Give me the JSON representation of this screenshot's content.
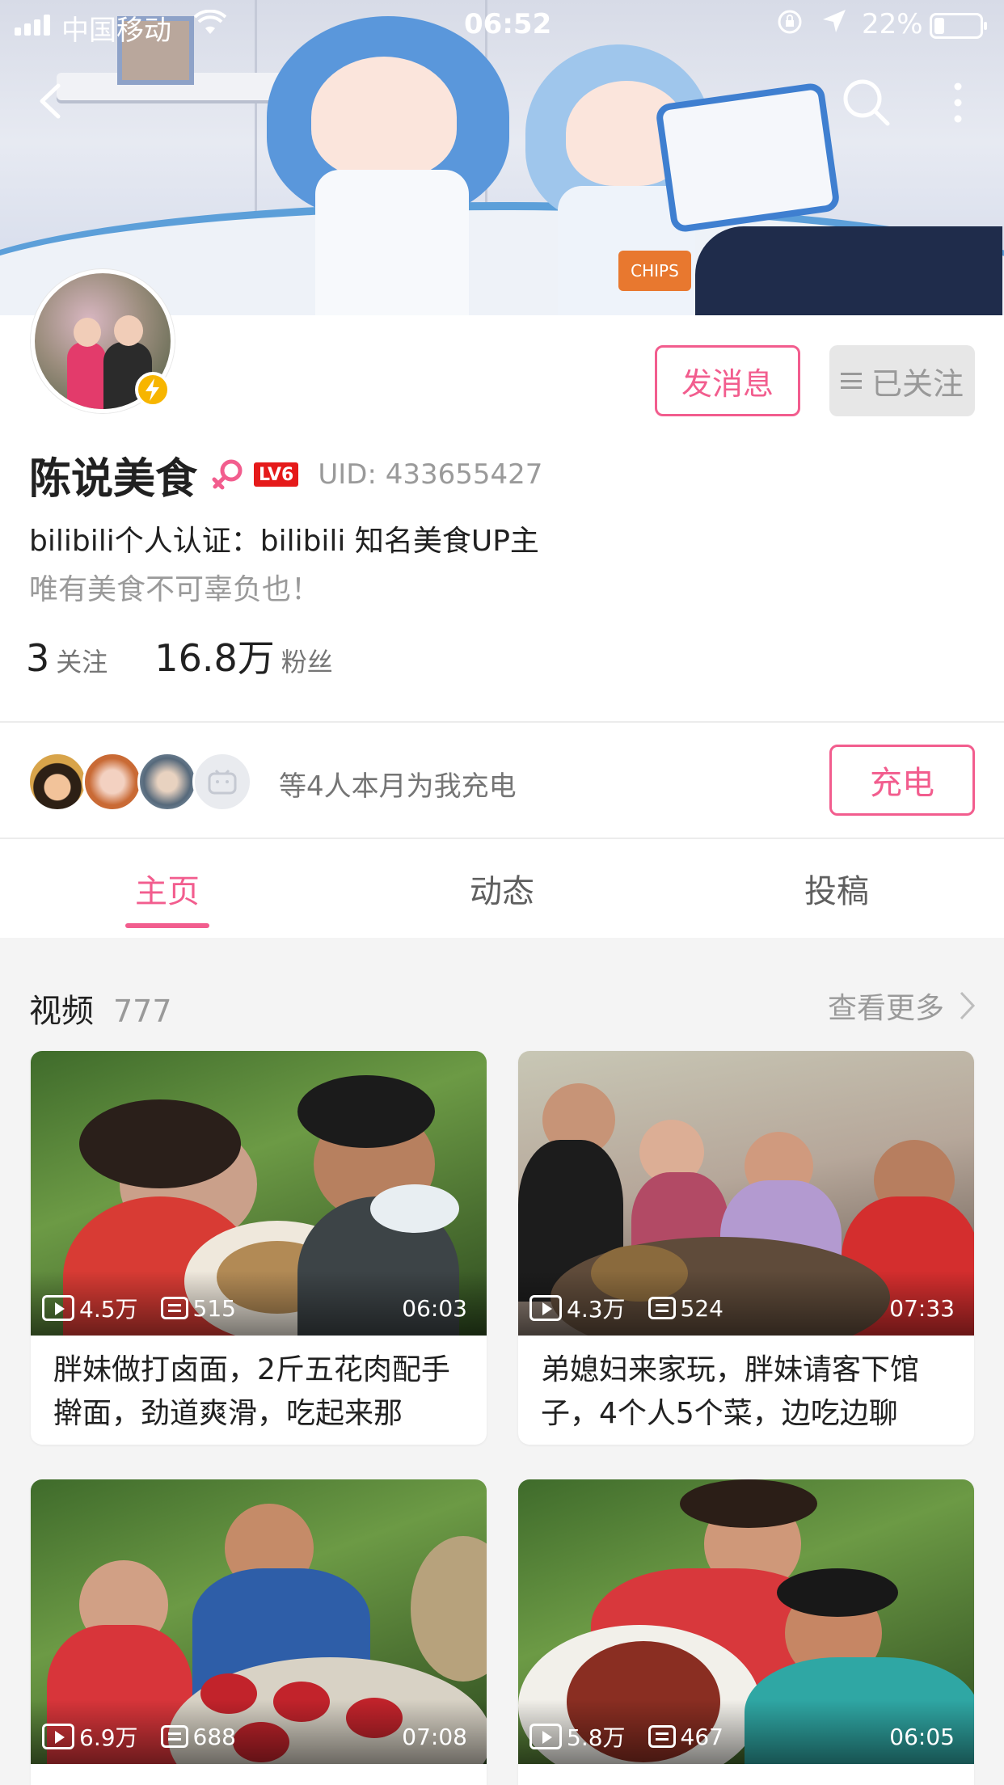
{
  "status_bar": {
    "carrier": "中国移动",
    "time": "06:52",
    "battery_pct": "22%",
    "battery_level": 0.22
  },
  "profile": {
    "name": "陈说美食",
    "level": "LV6",
    "uid_label": "UID:",
    "uid": "433655427",
    "certification": "bilibili个人认证：bilibili  知名美食UP主",
    "signature": "唯有美食不可辜负也！",
    "following_count": "3",
    "following_label": "关注",
    "fans_count": "16.8万",
    "fans_label": "粉丝"
  },
  "actions": {
    "message_label": "发消息",
    "followed_label": "已关注"
  },
  "charge": {
    "text": "等4人本月为我充电",
    "button_label": "充电"
  },
  "tabs": [
    {
      "label": "主页",
      "active": true
    },
    {
      "label": "动态",
      "active": false
    },
    {
      "label": "投稿",
      "active": false
    }
  ],
  "videos_section": {
    "title": "视频",
    "count": "777",
    "more_label": "查看更多"
  },
  "videos": [
    {
      "views": "4.5万",
      "danmaku": "515",
      "duration": "06:03",
      "title": "胖妹做打卤面，2斤五花肉配手擀面，劲道爽滑，吃起来那"
    },
    {
      "views": "4.3万",
      "danmaku": "524",
      "duration": "07:33",
      "title": "弟媳妇来家玩，胖妹请客下馆子，4个人5个菜，边吃边聊"
    },
    {
      "views": "6.9万",
      "danmaku": "688",
      "duration": "07:08",
      "title": ""
    },
    {
      "views": "5.8万",
      "danmaku": "467",
      "duration": "06:05",
      "title": ""
    }
  ],
  "colors": {
    "accent": "#f25d8e",
    "level_badge": "#e51a1a",
    "verify_badge": "#f7b500"
  }
}
